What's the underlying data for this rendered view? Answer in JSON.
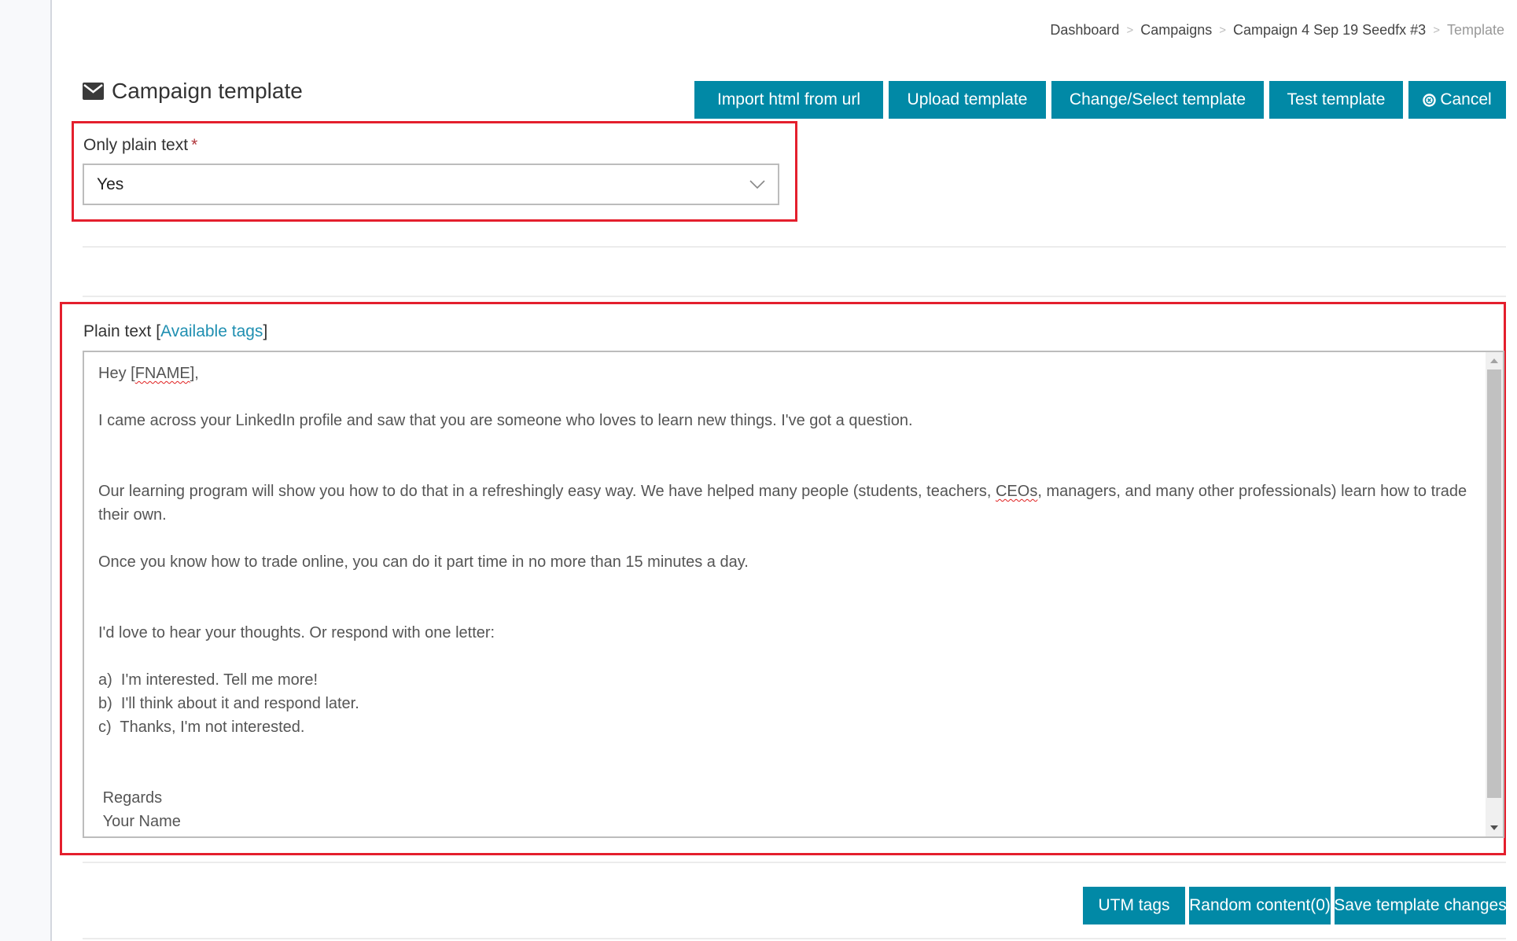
{
  "breadcrumb": [
    {
      "label": "Dashboard",
      "current": false
    },
    {
      "label": "Campaigns",
      "current": false
    },
    {
      "label": "Campaign 4 Sep 19 Seedfx #3",
      "current": false
    },
    {
      "label": "Template",
      "current": true
    }
  ],
  "breadcrumb_separator": ">",
  "header": {
    "icon": "envelope-icon",
    "title": "Campaign template"
  },
  "toolbar": {
    "import_label": "Import html from url",
    "upload_label": "Upload template",
    "change_label": "Change/Select template",
    "test_label": "Test template",
    "cancel_label": "Cancel",
    "cancel_icon": "times-circle-icon"
  },
  "plain_text_only": {
    "label": "Only plain text",
    "required_marker": "*",
    "value": "Yes"
  },
  "plain_text": {
    "label_prefix": "Plain text [",
    "link_label": "Available tags",
    "label_suffix": "]",
    "lines": [
      "Hey [FNAME],",
      "",
      "I came across your LinkedIn profile and saw that you are someone who loves to learn new things. I've got a question.",
      "",
      "",
      "Our learning program will show you how to do that in a refreshingly easy way. We have helped many people (students, teachers, CEOs, managers, and many other professionals) learn how to trade their own.",
      "",
      "Once you know how to trade online, you can do it part time in no more than 15 minutes a day.",
      "",
      "",
      "I'd love to hear your thoughts. Or respond with one letter:",
      "",
      "a)  I'm interested. Tell me more!",
      "b)  I'll think about it and respond later.",
      "c)  Thanks, I'm not interested.",
      "",
      "",
      " Regards",
      " Your Name"
    ],
    "misspelled_words": [
      "FNAME",
      "CEOs"
    ]
  },
  "footer_buttons": {
    "utm_label": "UTM tags",
    "random_label": "Random content(0)",
    "save_label": "Save template changes"
  },
  "colors": {
    "button": "#0189a6",
    "link": "#1f8fb1",
    "highlight": "#e41f2d",
    "required": "#b0363b"
  }
}
